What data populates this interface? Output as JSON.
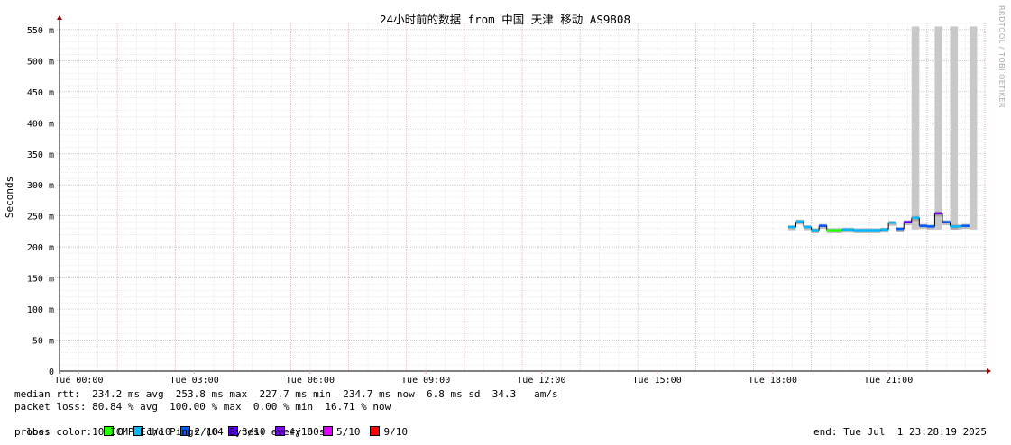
{
  "watermark": "RRDTOOL / TOBI OETIKER",
  "chart_data": {
    "type": "line",
    "title": "24小时前的数据 from 中国 天津 移动 AS9808",
    "ylabel": "Seconds",
    "y_unit_suffix": "m",
    "ylim": [
      0,
      560
    ],
    "y_ticks": [
      "0",
      "50 m",
      "100 m",
      "150 m",
      "200 m",
      "250 m",
      "300 m",
      "350 m",
      "400 m",
      "450 m",
      "500 m",
      "550 m"
    ],
    "y_tick_values": [
      0,
      50,
      100,
      150,
      200,
      250,
      300,
      350,
      400,
      450,
      500,
      550
    ],
    "x_unit": "hours",
    "xlim": [
      -0.5,
      23.5
    ],
    "x_ticks": [
      "Tue 00:00",
      "Tue 03:00",
      "Tue 06:00",
      "Tue 09:00",
      "Tue 12:00",
      "Tue 15:00",
      "Tue 18:00",
      "Tue 21:00"
    ],
    "x_tick_values": [
      0,
      3,
      6,
      9,
      12,
      15,
      18,
      21
    ],
    "grid": true,
    "colors": {
      "grid_major": "#f0a0a0",
      "grid_minor": "#dddddd",
      "axis": "#000000",
      "arrow": "#8b0000",
      "loss_bar": "#c8c8c8",
      "smoke": "#888888"
    },
    "median_series": [
      {
        "x": 18.4,
        "y": 232,
        "loss": 1
      },
      {
        "x": 18.6,
        "y": 241,
        "loss": 1
      },
      {
        "x": 18.8,
        "y": 232,
        "loss": 1
      },
      {
        "x": 19.0,
        "y": 227,
        "loss": 1
      },
      {
        "x": 19.2,
        "y": 234,
        "loss": 2
      },
      {
        "x": 19.4,
        "y": 227,
        "loss": 0
      },
      {
        "x": 19.8,
        "y": 228,
        "loss": 1
      },
      {
        "x": 20.1,
        "y": 227,
        "loss": 1
      },
      {
        "x": 20.8,
        "y": 228,
        "loss": 1
      },
      {
        "x": 21.0,
        "y": 239,
        "loss": 1
      },
      {
        "x": 21.2,
        "y": 229,
        "loss": 2
      },
      {
        "x": 21.4,
        "y": 240,
        "loss": 3
      },
      {
        "x": 21.6,
        "y": 247,
        "loss": 1
      },
      {
        "x": 21.8,
        "y": 234,
        "loss": 2
      },
      {
        "x": 22.0,
        "y": 233,
        "loss": 2
      },
      {
        "x": 22.2,
        "y": 254,
        "loss": 4
      },
      {
        "x": 22.4,
        "y": 240,
        "loss": 2
      },
      {
        "x": 22.6,
        "y": 233,
        "loss": 1
      },
      {
        "x": 22.9,
        "y": 234,
        "loss": 2
      }
    ],
    "loss_bars": [
      {
        "x_start": 21.6,
        "x_end": 21.8,
        "y": 555
      },
      {
        "x_start": 22.2,
        "x_end": 22.4,
        "y": 555
      },
      {
        "x_start": 22.6,
        "x_end": 22.8,
        "y": 555
      },
      {
        "x_start": 23.1,
        "x_end": 23.3,
        "y": 555
      }
    ],
    "x_end": 23.1
  },
  "legend": {
    "median_rtt": "median rtt:  234.2 ms avg  253.8 ms max  227.7 ms min  234.7 ms now  6.8 ms sd  34.3   am/s",
    "packet_loss": "packet loss: 80.84 % avg  100.00 % max  0.00 % min  16.71 % now",
    "loss_color_label": "loss color:",
    "loss_colors": [
      {
        "label": "0",
        "color": "#26ff00"
      },
      {
        "label": "1/10",
        "color": "#00b8ff"
      },
      {
        "label": "2/10",
        "color": "#0059ff"
      },
      {
        "label": "3/10",
        "color": "#5e00ff"
      },
      {
        "label": "4/10",
        "color": "#7e00ff"
      },
      {
        "label": "5/10",
        "color": "#dd00ff"
      },
      {
        "label": "9/10",
        "color": "#ff0000"
      }
    ],
    "probe": "probe:       10 ICMP Echo Pings (64 Bytes) every 60s",
    "end": "end: Tue Jul  1 23:28:19 2025"
  }
}
